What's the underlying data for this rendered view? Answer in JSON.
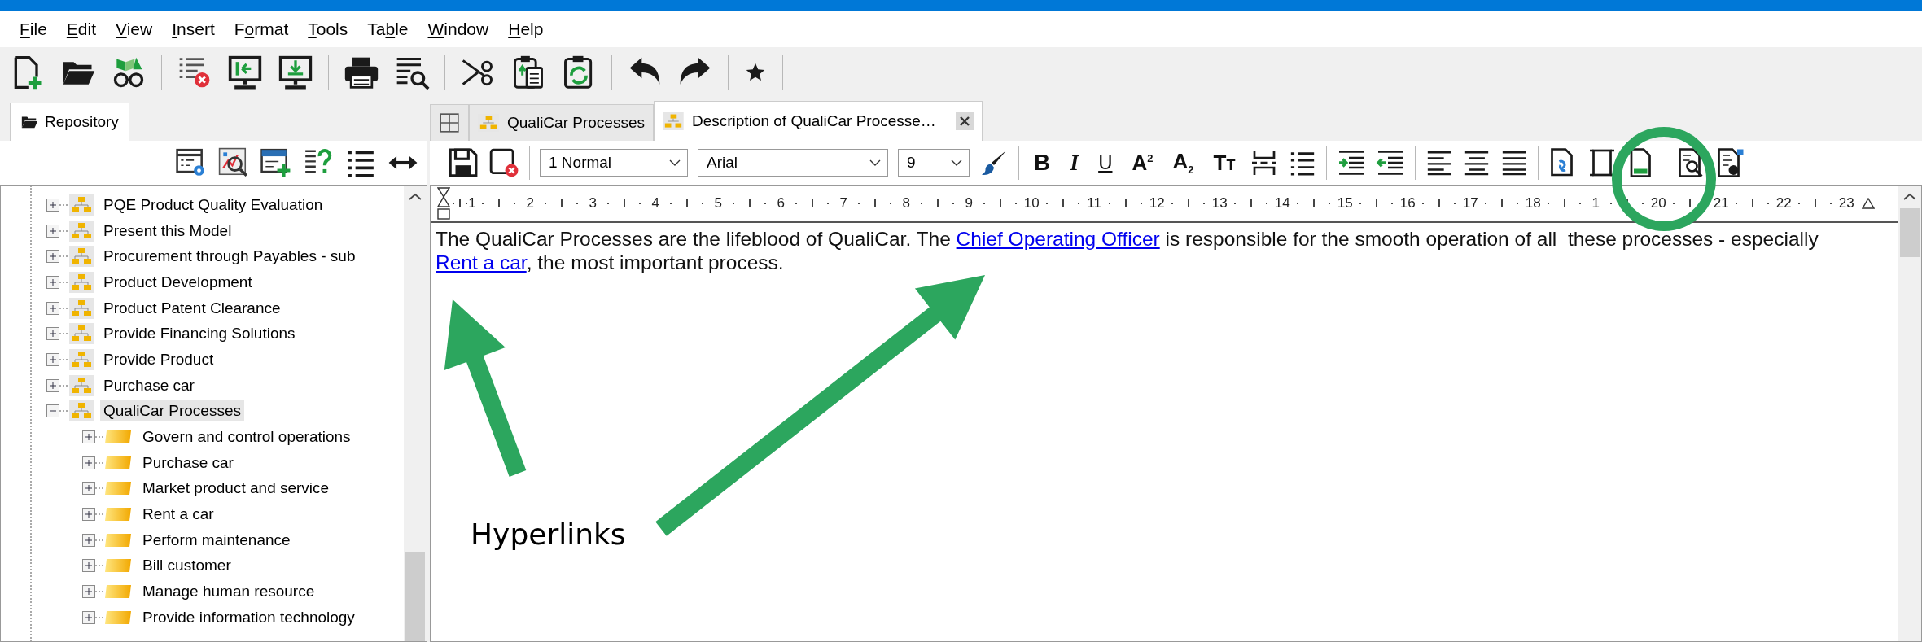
{
  "menu": [
    {
      "key": "F",
      "after": "ile"
    },
    {
      "key": "E",
      "after": "dit"
    },
    {
      "key": "V",
      "after": "iew"
    },
    {
      "key": "I",
      "after": "nsert"
    },
    {
      "before": "F",
      "key": "o",
      "after": "rmat"
    },
    {
      "key": "T",
      "after": "ools"
    },
    {
      "before": "Ta",
      "key": "b",
      "after": "le"
    },
    {
      "key": "W",
      "after": "indow"
    },
    {
      "key": "H",
      "after": "elp"
    }
  ],
  "left_panel": {
    "tabs": [
      {
        "label": "Repository",
        "selected": true
      }
    ],
    "tree": [
      {
        "label": "PQE Product Quality Evaluation",
        "kind": "model",
        "expanded": false,
        "selected": false
      },
      {
        "label": "Present this Model",
        "kind": "model",
        "expanded": false,
        "selected": false
      },
      {
        "label": "Procurement through Payables - sub",
        "kind": "model",
        "expanded": false,
        "selected": false
      },
      {
        "label": "Product Development",
        "kind": "model",
        "expanded": false,
        "selected": false
      },
      {
        "label": "Product Patent Clearance",
        "kind": "model",
        "expanded": false,
        "selected": false
      },
      {
        "label": "Provide Financing Solutions",
        "kind": "model",
        "expanded": false,
        "selected": false
      },
      {
        "label": "Provide Product",
        "kind": "model",
        "expanded": false,
        "selected": false
      },
      {
        "label": "Purchase car",
        "kind": "model",
        "expanded": false,
        "selected": false
      },
      {
        "label": "QualiCar Processes",
        "kind": "model",
        "expanded": true,
        "selected": true,
        "children": [
          {
            "label": "Govern and control operations",
            "kind": "group",
            "expanded": false,
            "selected": false
          },
          {
            "label": "Purchase car",
            "kind": "group",
            "expanded": false,
            "selected": false
          },
          {
            "label": "Market product and service",
            "kind": "group",
            "expanded": false,
            "selected": false
          },
          {
            "label": "Rent a car",
            "kind": "group",
            "expanded": false,
            "selected": false
          },
          {
            "label": "Perform maintenance",
            "kind": "group",
            "expanded": false,
            "selected": false
          },
          {
            "label": "Bill customer",
            "kind": "group",
            "expanded": false,
            "selected": false
          },
          {
            "label": "Manage human resource",
            "kind": "group",
            "expanded": false,
            "selected": false
          },
          {
            "label": "Provide information technology",
            "kind": "group",
            "expanded": false,
            "selected": false
          }
        ]
      }
    ]
  },
  "editor": {
    "tabs": [
      {
        "kind": "grid",
        "selected": false
      },
      {
        "kind": "model",
        "label": "QualiCar Processes",
        "selected": false
      },
      {
        "kind": "model",
        "label": "Description of QualiCar Processe…",
        "selected": true,
        "closable": true
      }
    ],
    "style": "1 Normal",
    "font": "Arial",
    "size": "9",
    "format_buttons": [
      {
        "kind": "bold",
        "label": "B"
      },
      {
        "kind": "italic",
        "label": "I"
      },
      {
        "kind": "underline",
        "label": "U"
      },
      {
        "kind": "superscript",
        "label": "A$^{2}$"
      },
      {
        "kind": "subscript",
        "label": "A$_{2}$"
      },
      {
        "kind": "smallcaps",
        "label": "TT"
      }
    ],
    "ruler_marks": [
      "1",
      "2",
      "3",
      "4",
      "5",
      "6",
      "7",
      "8",
      "9",
      "10",
      "11",
      "12",
      "13",
      "14",
      "15",
      "16",
      "17",
      "18",
      "1",
      "20",
      "21",
      "22",
      "23"
    ],
    "paragraph": [
      {
        "kind": "text",
        "text": "The QualiCar Processes are the lifeblood of QualiCar. The "
      },
      {
        "kind": "link",
        "text": "Chief Operating Officer"
      },
      {
        "kind": "text",
        "text": " is responsible for the smooth operation of all  these processes - especially "
      },
      {
        "kind": "link",
        "text": "Rent a car"
      },
      {
        "kind": "text",
        "text": ", the most important process."
      }
    ]
  },
  "annotation": {
    "label": "Hyperlinks"
  }
}
